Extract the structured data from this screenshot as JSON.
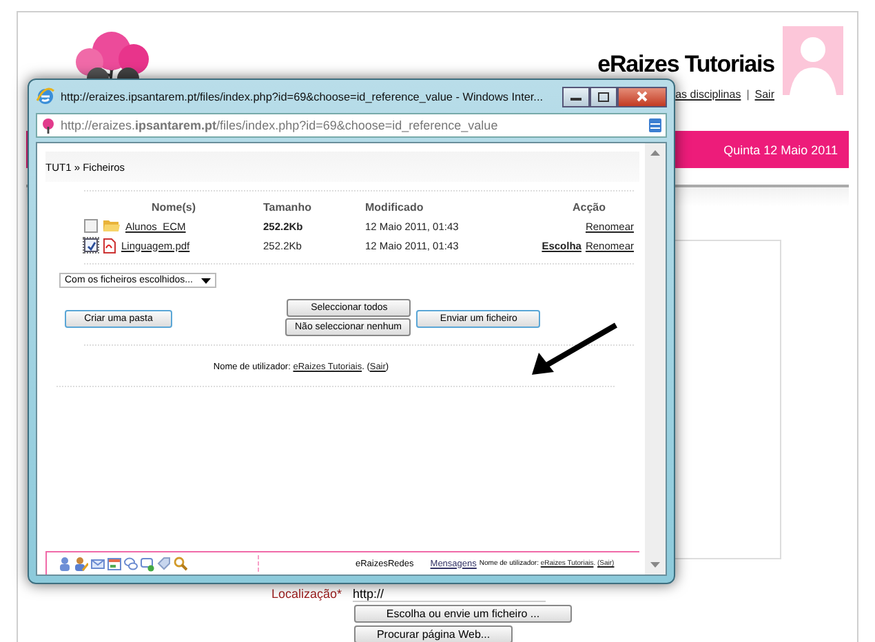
{
  "background_page": {
    "site_title": "eRaizes Tutoriais",
    "links": [
      {
        "label": "as disciplinas"
      },
      {
        "label": "Sair"
      }
    ],
    "link_separator": "|",
    "date": "Quinta 12 Maio 2011",
    "form": {
      "label": "Localização*",
      "url_value": "http://",
      "buttons": [
        "Escolha ou envie um ficheiro ...",
        "Procurar página Web..."
      ]
    }
  },
  "popup": {
    "title": "http://eraizes.ipsantarem.pt/files/index.php?id=69&choose=id_reference_value - Windows Inter...",
    "address": "http://eraizes.**ipsantarem.pt**/files/index.php?id=69&choose=id_reference_value",
    "breadcrumb": "TUT1 » Ficheiros",
    "table": {
      "columns": [
        "Nome(s)",
        "Tamanho",
        "Modificado",
        "Acção"
      ],
      "rows": [
        {
          "kind": "folder",
          "checked": false,
          "name": "Alunos_ECM",
          "size": "252.2Kb",
          "size_bold": true,
          "modified": "12 Maio 2011, 01:43",
          "actions": [
            {
              "kind": "rename",
              "label": "Renomear"
            }
          ]
        },
        {
          "kind": "pdf",
          "checked": true,
          "name": "Linguagem.pdf",
          "size": "252.2Kb",
          "size_bold": false,
          "modified": "12 Maio 2011, 01:43",
          "actions": [
            {
              "kind": "choose",
              "label": "Escolha"
            },
            {
              "kind": "rename",
              "label": "Renomear"
            }
          ]
        }
      ]
    },
    "dropdown": "Com os ficheiros escolhidos...",
    "buttons": {
      "create_folder": "Criar uma pasta",
      "select_all": "Seleccionar todos",
      "select_none": "Não seleccionar nenhum",
      "upload": "Enviar um ficheiro"
    },
    "login": {
      "prefix": "Nome de utilizador: ",
      "user": "eRaizes Tutoriais",
      "middle": ". (",
      "logout": "Sair",
      "suffix": ")"
    },
    "footer": {
      "site": "eRaizesRedes",
      "messages": "Mensagens",
      "login_text": "Nome de utilizador: ",
      "user": "eRaizes Tutoriais",
      "middle": ". ",
      "logout": "(Sair)"
    }
  }
}
